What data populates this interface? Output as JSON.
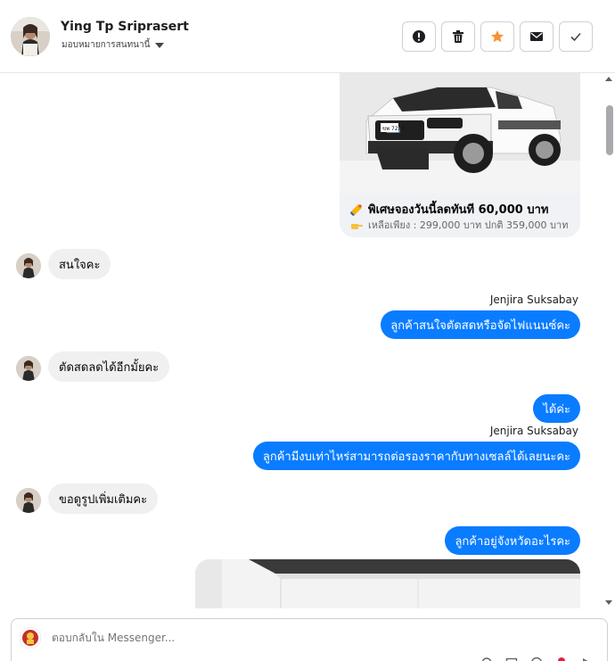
{
  "header": {
    "contact_name": "Ying Tp Sriprasert",
    "assign_label": "มอบหมายการสนทนานี้",
    "actions": [
      {
        "name": "report-icon",
        "label": "report"
      },
      {
        "name": "trash-icon",
        "label": "delete"
      },
      {
        "name": "star-icon",
        "label": "follow up"
      },
      {
        "name": "envelope-icon",
        "label": "mark unread"
      },
      {
        "name": "check-icon",
        "label": "done"
      }
    ]
  },
  "colors": {
    "accent_blue": "#0a7cff",
    "incoming_bubble": "#f0f0f0",
    "star_orange": "#f7923a",
    "border": "#ccd0d5"
  },
  "card": {
    "title": "พิเศษจองวันนี้ลดทันที 60,000 บาท",
    "subtitle": "เหลือเพียง : 299,000 บาท ปกติ 359,000 บาท",
    "plate": "ขพ 7283"
  },
  "messages": {
    "m1": "สนใจคะ",
    "m2_sender": "Jenjira Suksabay",
    "m2": "ลูกค้าสนใจตัดสดหรือจัดไฟแนนซ์คะ",
    "m3": "ตัดสดลดได้อีกมั้ยคะ",
    "m4": "ได้ค่ะ",
    "m5_sender": "Jenjira Suksabay",
    "m5": "ลูกค้ามีงบเท่าไหร่สามารถต่อรองราคากับทางเซลล์ได้เลยนะคะ",
    "m6": "ขอดูรูปเพิ่มเติมคะ",
    "m7": "ลูกค้าอยู่จังหวัดอะไรคะ"
  },
  "composer": {
    "placeholder": "ตอบกลับใน Messenger..."
  }
}
